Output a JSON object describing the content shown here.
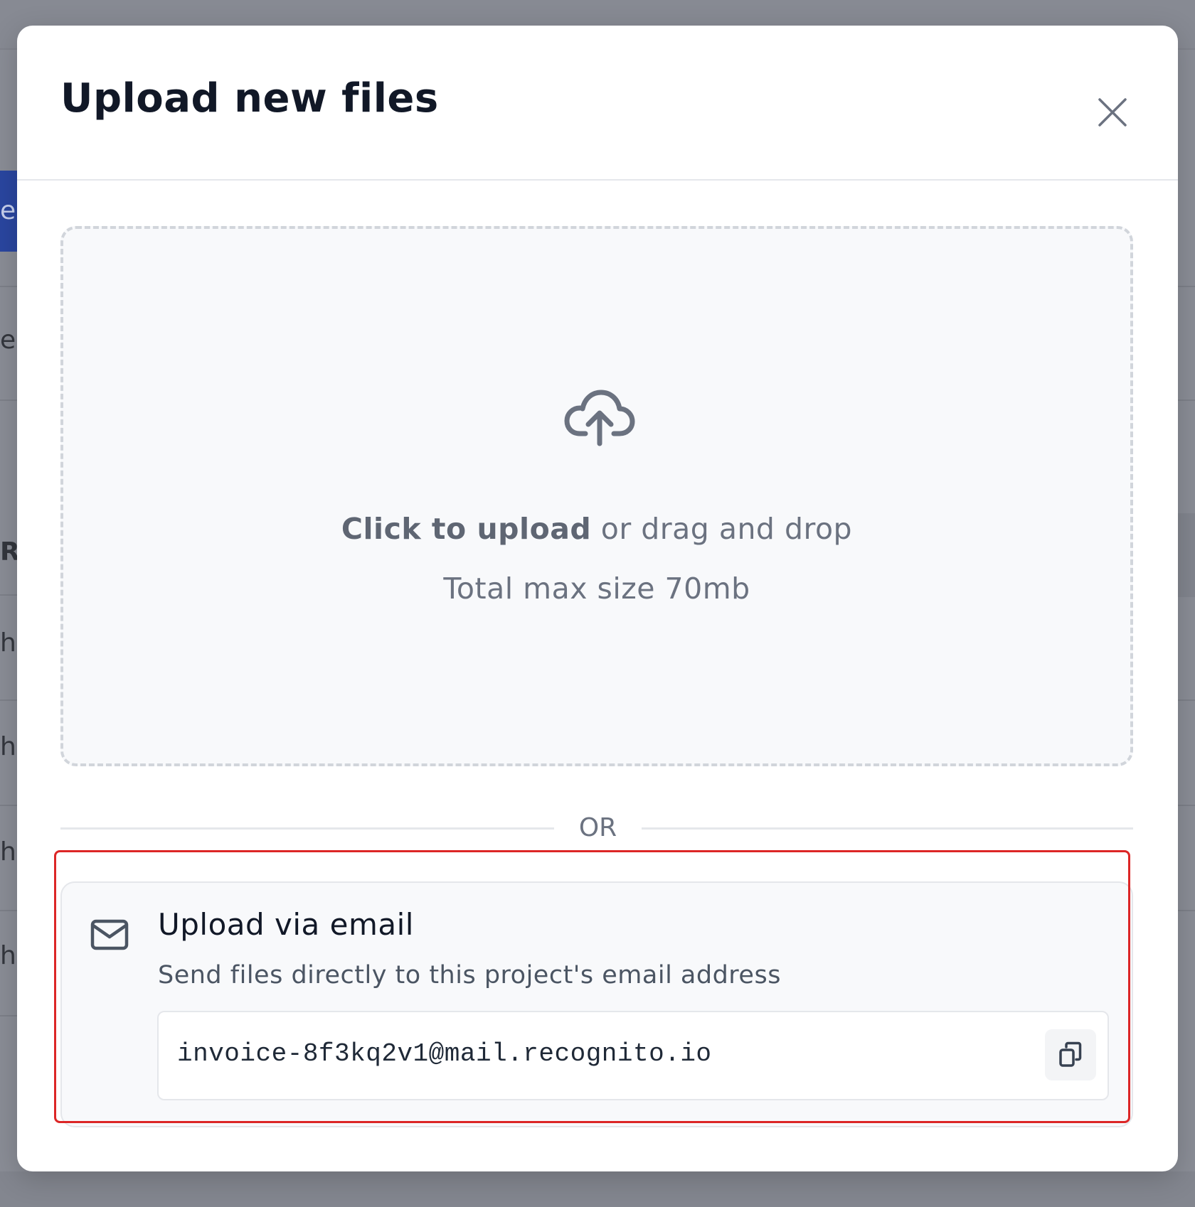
{
  "modal": {
    "title": "Upload new files",
    "close_icon": "close-icon"
  },
  "dropzone": {
    "icon": "cloud-upload-icon",
    "click_text": "Click to upload",
    "drag_text": " or drag and drop",
    "max_size": "Total max size 70mb"
  },
  "divider": {
    "label": "OR"
  },
  "email_upload": {
    "icon": "mail-icon",
    "title": "Upload via email",
    "description": "Send files directly to this project's email address",
    "address": "invoice-8f3kq2v1@mail.recognito.io",
    "copy_icon": "copy-icon"
  },
  "background_fragments": {
    "button_glyph": "e",
    "row1": "ec",
    "header": "R",
    "row2": "hc",
    "row3": "hc",
    "row4": "hc",
    "row5": "hc"
  },
  "colors": {
    "highlight": "#dc2626",
    "overlay": "#8a8d96",
    "brand_blue": "#2a46a0"
  }
}
